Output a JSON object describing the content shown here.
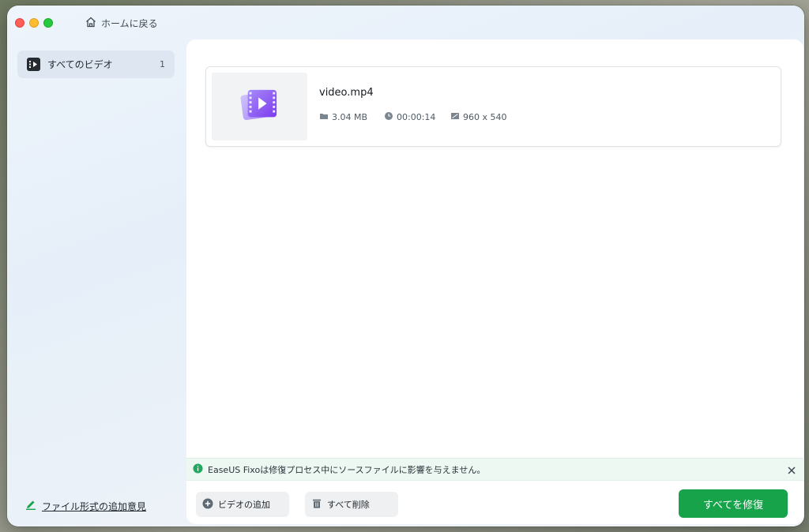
{
  "titlebar": {
    "home_label": "ホームに戻る"
  },
  "sidebar": {
    "items": [
      {
        "label": "すべてのビデオ",
        "count": "1",
        "icon": "video-list-icon"
      }
    ],
    "feedback_label": "ファイル形式の追加意見"
  },
  "files": [
    {
      "name": "video.mp4",
      "size": "3.04 MB",
      "duration": "00:00:14",
      "resolution": "960 x 540"
    }
  ],
  "notice": {
    "text": "EaseUS Fixoは修復プロセス中にソースファイルに影響を与えません。"
  },
  "buttons": {
    "add_video": "ビデオの追加",
    "delete_all": "すべて削除",
    "repair_all": "すべてを修復"
  },
  "colors": {
    "primary": "#16a34a",
    "notice_bg": "#eef8f3",
    "video_thumb_purple": "#8b5cf6"
  }
}
